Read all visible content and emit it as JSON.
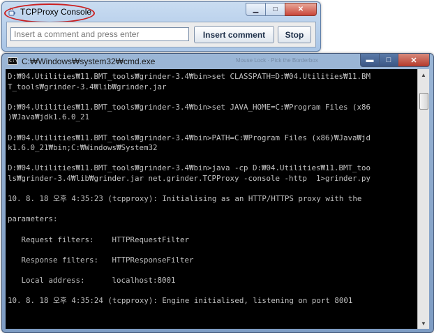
{
  "proxy_window": {
    "title": "TCPProxy Console",
    "comment_placeholder": "Insert a comment and press enter",
    "insert_button": "Insert comment",
    "stop_button": "Stop",
    "min_glyph": "▁",
    "max_glyph": "□",
    "close_glyph": "✕"
  },
  "cmd_window": {
    "title": "C:₩Windows₩system32₩cmd.exe",
    "icon_text": "C:\\",
    "faint_caption": "Mouse Lock · Pick the Borderbox",
    "min_glyph": "▬",
    "max_glyph": "□",
    "close_glyph": "✕",
    "console_lines": [
      "D:₩04.Utilities₩11.BMT_tools₩grinder-3.4₩bin>set CLASSPATH=D:₩04.Utilities₩11.BM",
      "T_tools₩grinder-3.4₩lib₩grinder.jar",
      "",
      "D:₩04.Utilities₩11.BMT_tools₩grinder-3.4₩bin>set JAVA_HOME=C:₩Program Files (x86",
      ")₩Java₩jdk1.6.0_21",
      "",
      "D:₩04.Utilities₩11.BMT_tools₩grinder-3.4₩bin>PATH=C:₩Program Files (x86)₩Java₩jd",
      "k1.6.0_21₩bin;C:₩Windows₩System32",
      "",
      "D:₩04.Utilities₩11.BMT_tools₩grinder-3.4₩bin>java -cp D:₩04.Utilities₩11.BMT_too",
      "ls₩grinder-3.4₩lib₩grinder.jar net.grinder.TCPProxy -console -http  1>grinder.py",
      "",
      "10. 8. 18 오후 4:35:23 (tcpproxy): Initialising as an HTTP/HTTPS proxy with the",
      "",
      "parameters:",
      "",
      "   Request filters:    HTTPRequestFilter",
      "",
      "   Response filters:   HTTPResponseFilter",
      "",
      "   Local address:      localhost:8001",
      "",
      "10. 8. 18 오후 4:35:24 (tcpproxy): Engine initialised, listening on port 8001"
    ],
    "scroll_up_glyph": "▲",
    "scroll_down_glyph": "▼"
  }
}
